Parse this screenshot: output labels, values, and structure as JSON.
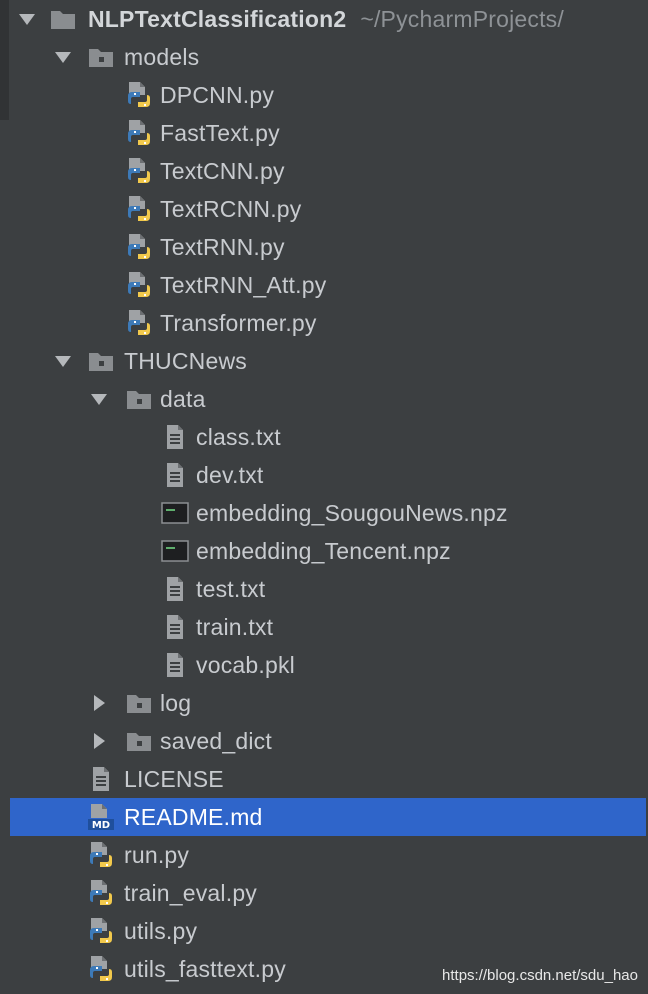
{
  "project": {
    "name": "NLPTextClassification2",
    "path": "~/PycharmProjects/"
  },
  "tree": [
    {
      "id": "root",
      "depth": 0,
      "type": "folder",
      "label": "NLPTextClassification2",
      "expanded": true,
      "icon": "folder-icon"
    },
    {
      "id": "models",
      "depth": 1,
      "type": "package",
      "label": "models",
      "expanded": true,
      "icon": "package-folder-icon"
    },
    {
      "id": "dpcnn",
      "depth": 2,
      "type": "python",
      "label": "DPCNN.py",
      "icon": "python-file-icon"
    },
    {
      "id": "fasttext",
      "depth": 2,
      "type": "python",
      "label": "FastText.py",
      "icon": "python-file-icon"
    },
    {
      "id": "textcnn",
      "depth": 2,
      "type": "python",
      "label": "TextCNN.py",
      "icon": "python-file-icon"
    },
    {
      "id": "textrcnn",
      "depth": 2,
      "type": "python",
      "label": "TextRCNN.py",
      "icon": "python-file-icon"
    },
    {
      "id": "textrnn",
      "depth": 2,
      "type": "python",
      "label": "TextRNN.py",
      "icon": "python-file-icon"
    },
    {
      "id": "textrnn-att",
      "depth": 2,
      "type": "python",
      "label": "TextRNN_Att.py",
      "icon": "python-file-icon"
    },
    {
      "id": "transformer",
      "depth": 2,
      "type": "python",
      "label": "Transformer.py",
      "icon": "python-file-icon"
    },
    {
      "id": "thucnews",
      "depth": 1,
      "type": "package",
      "label": "THUCNews",
      "expanded": true,
      "icon": "package-folder-icon"
    },
    {
      "id": "data",
      "depth": 2,
      "type": "package",
      "label": "data",
      "expanded": true,
      "icon": "package-folder-icon"
    },
    {
      "id": "class-txt",
      "depth": 3,
      "type": "text",
      "label": "class.txt",
      "icon": "text-file-icon"
    },
    {
      "id": "dev-txt",
      "depth": 3,
      "type": "text",
      "label": "dev.txt",
      "icon": "text-file-icon"
    },
    {
      "id": "emb-sougou",
      "depth": 3,
      "type": "binary",
      "label": "embedding_SougouNews.npz",
      "icon": "binary-file-icon"
    },
    {
      "id": "emb-tencent",
      "depth": 3,
      "type": "binary",
      "label": "embedding_Tencent.npz",
      "icon": "binary-file-icon"
    },
    {
      "id": "test-txt",
      "depth": 3,
      "type": "text",
      "label": "test.txt",
      "icon": "text-file-icon"
    },
    {
      "id": "train-txt",
      "depth": 3,
      "type": "text",
      "label": "train.txt",
      "icon": "text-file-icon"
    },
    {
      "id": "vocab-pkl",
      "depth": 3,
      "type": "text",
      "label": "vocab.pkl",
      "icon": "text-file-icon"
    },
    {
      "id": "log",
      "depth": 2,
      "type": "package",
      "label": "log",
      "expanded": false,
      "icon": "package-folder-icon"
    },
    {
      "id": "saved-dict",
      "depth": 2,
      "type": "package",
      "label": "saved_dict",
      "expanded": false,
      "icon": "package-folder-icon"
    },
    {
      "id": "license",
      "depth": 1,
      "type": "text",
      "label": "LICENSE",
      "icon": "text-file-icon"
    },
    {
      "id": "readme",
      "depth": 1,
      "type": "markdown",
      "label": "README.md",
      "icon": "markdown-file-icon",
      "selected": true
    },
    {
      "id": "run-py",
      "depth": 1,
      "type": "python",
      "label": "run.py",
      "icon": "python-file-icon"
    },
    {
      "id": "train-eval-py",
      "depth": 1,
      "type": "python",
      "label": "train_eval.py",
      "icon": "python-file-icon"
    },
    {
      "id": "utils-py",
      "depth": 1,
      "type": "python",
      "label": "utils.py",
      "icon": "python-file-icon"
    },
    {
      "id": "utils-fasttext-py",
      "depth": 1,
      "type": "python",
      "label": "utils_fasttext.py",
      "icon": "python-file-icon"
    }
  ],
  "watermark": "https://blog.csdn.net/sdu_hao",
  "colors": {
    "background": "#3c3f41",
    "selection": "#2f65ca",
    "text": "#c8cbcf",
    "path_text": "#8e9296",
    "folder": "#8a8d90",
    "python_blue": "#3d7ab8",
    "python_yellow": "#f2c94c"
  }
}
